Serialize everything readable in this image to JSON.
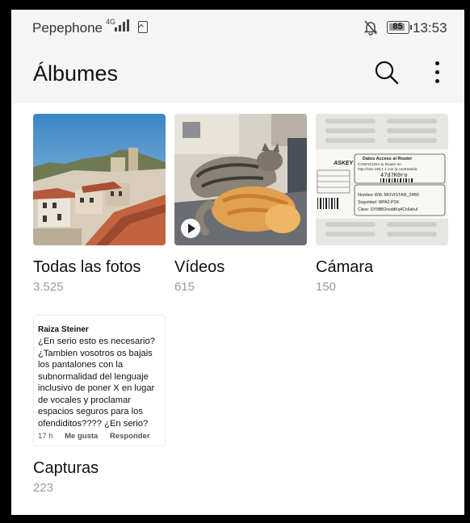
{
  "status_bar": {
    "carrier": "Pepephone",
    "network": "4G",
    "battery": "85",
    "time": "13:53"
  },
  "app_bar": {
    "title": "Álbumes",
    "search_icon": "search-icon",
    "more_icon": "more-vert-icon"
  },
  "albums": [
    {
      "name": "Todas las fotos",
      "count": "3.525"
    },
    {
      "name": "Vídeos",
      "count": "615"
    },
    {
      "name": "Cámara",
      "count": "150"
    },
    {
      "name": "Capturas",
      "count": "223"
    }
  ],
  "router_label": {
    "header": "Datos Access al Router",
    "brand": "ASKEY",
    "line1": "CONFIGURA tu Router en",
    "line2": "http://192.168.1.1 con la contraseña",
    "password": "47d7K0ro",
    "wifi": "Nombre Wifi: MOVISTAR_24B0",
    "security": "Seguridad: WPA2-PSK",
    "key": "Clave: SYNBB2neddKq4Cn6ahuf"
  },
  "capture_preview": {
    "author": "Raiza Steiner",
    "text": "¿En serio esto es necesario? ¿Tambien vosotros os bajais los pantalones con la subnormalidad del lenguaje inclusivo de poner X en lugar de vocales y proclamar espacios seguros para los ofendiditos???? ¿En serio?",
    "time": "17 h",
    "like": "Me gusta",
    "reply": "Responder"
  },
  "colors": {
    "background": "#f5f5f5",
    "content": "#ffffff",
    "count_gray": "#9a9a9a"
  }
}
